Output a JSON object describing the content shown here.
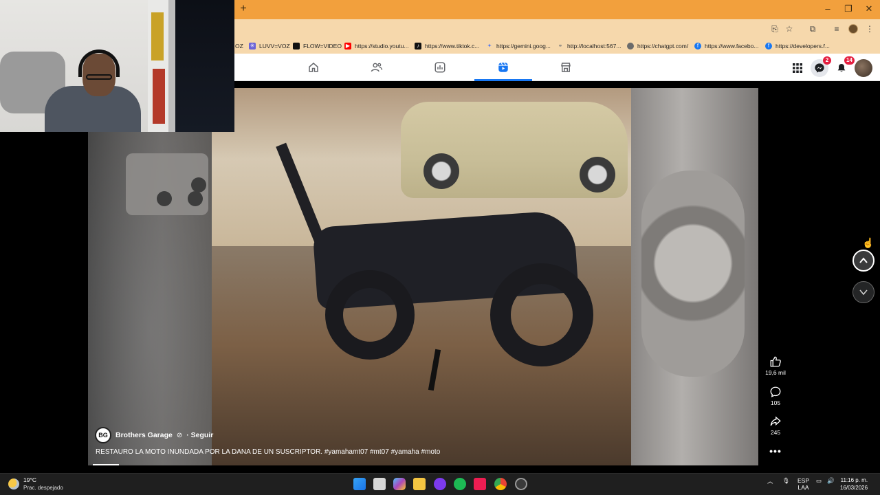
{
  "browser": {
    "new_tab_label": "+",
    "window_controls": {
      "minimize": "–",
      "maximize": "❐",
      "close": "✕"
    },
    "bookmarks": [
      {
        "label": "OZ",
        "icon": "folder-icon",
        "color": "#7a5b2a"
      },
      {
        "label": "LUVV=VOZ",
        "icon": "grid-icon",
        "color": "#6b63d6"
      },
      {
        "label": "FLOW=VIDEO",
        "icon": "square-icon",
        "color": "#111111"
      },
      {
        "label": "https://studio.youtu...",
        "icon": "youtube-icon",
        "color": "#ff0000"
      },
      {
        "label": "https://www.tiktok.c...",
        "icon": "tiktok-icon",
        "color": "#111111"
      },
      {
        "label": "https://gemini.goog...",
        "icon": "gemini-icon",
        "color": "#5b7cf0"
      },
      {
        "label": "http://localhost:567...",
        "icon": "link-icon",
        "color": "#7a7a7a"
      },
      {
        "label": "https://chatgpt.com/",
        "icon": "globe-icon",
        "color": "#6b6b6b"
      },
      {
        "label": "https://www.facebo...",
        "icon": "facebook-icon",
        "color": "#1877f2"
      },
      {
        "label": "https://developers.f...",
        "icon": "facebook-icon",
        "color": "#1877f2"
      }
    ]
  },
  "facebook": {
    "nav_tabs": [
      {
        "name": "home",
        "icon": "home-icon"
      },
      {
        "name": "friends",
        "icon": "friends-icon"
      },
      {
        "name": "dashboard",
        "icon": "dashboard-icon"
      },
      {
        "name": "reels",
        "icon": "reels-icon",
        "active": true
      },
      {
        "name": "marketplace",
        "icon": "marketplace-icon"
      }
    ],
    "messenger_badge": "2",
    "notifications_badge": "14",
    "accent_color": "#1877f2"
  },
  "reel": {
    "author": "Brothers Garage",
    "author_initials": "BG",
    "separator_follow": "· Seguir",
    "caption": "RESTAURO LA MOTO INUNDADA POR LA DANA DE UN SUSCRIPTOR. #yamahamt07 #mt07 #yamaha #moto",
    "likes": "19,6 mil",
    "comments": "105",
    "shares": "245",
    "more": "•••"
  },
  "taskbar": {
    "temperature": "19°C",
    "weather": "Prac. despejado",
    "language_1": "ESP",
    "language_2": "LAA",
    "time": "11:16 p. m.",
    "date": "16/03/2026"
  }
}
